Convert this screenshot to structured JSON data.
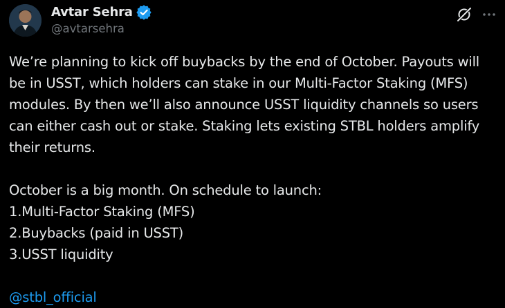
{
  "author": {
    "display_name": "Avtar Sehra",
    "handle": "@avtarsehra",
    "verified": true,
    "verified_color": "#1d9bf0"
  },
  "actions": {
    "grok_icon": "grok-icon",
    "more_icon": "more-icon"
  },
  "post": {
    "paragraph1_lines": [
      "We’re planning to kick off buybacks by the end of October. Payouts will",
      "be in USST, which holders can stake in our Multi-Factor Staking (MFS)",
      "modules. By then we’ll also announce USST liquidity channels so users",
      "can either cash out or stake. Staking lets existing STBL holders amplify",
      "their returns."
    ],
    "paragraph2_intro": "October is a big month. On schedule to launch:",
    "list_items": [
      "1.Multi-Factor Staking (MFS)",
      "2.Buybacks (paid in USST)",
      "3.USST liquidity"
    ],
    "mention": "@stbl_official"
  },
  "colors": {
    "background": "#000000",
    "text": "#e7e9ea",
    "secondary": "#71767b",
    "link": "#1d9bf0"
  }
}
